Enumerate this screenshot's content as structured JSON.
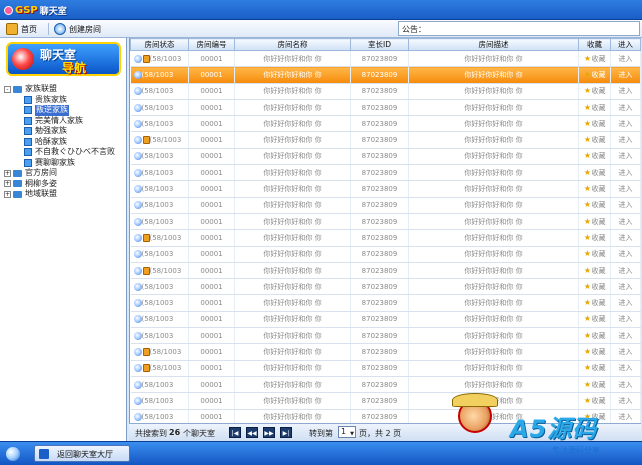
{
  "app": {
    "logo_text": "GSP",
    "logo_cn": "聊天室"
  },
  "toolbar": {
    "home_label": "首页",
    "create_label": "创建房间",
    "notice_label": "公告："
  },
  "sidebar": {
    "banner_line1": "聊天室",
    "banner_line2": "导航",
    "tree": [
      {
        "label": "家族联盟",
        "type": "group",
        "expanded": true
      },
      {
        "label": "贵族家族",
        "type": "leaf"
      },
      {
        "label": "叛逆家族",
        "type": "leaf",
        "selected": true
      },
      {
        "label": "完美情人家族",
        "type": "leaf"
      },
      {
        "label": "勉强家族",
        "type": "leaf"
      },
      {
        "label": "哈酥家族",
        "type": "leaf"
      },
      {
        "label": "不自救ぐひひべ不言败",
        "type": "leaf"
      },
      {
        "label": "赛聊聊家族",
        "type": "leaf"
      },
      {
        "label": "官方房间",
        "type": "group",
        "expanded": false
      },
      {
        "label": "桐柳多姿",
        "type": "group",
        "expanded": false
      },
      {
        "label": "地域联盟",
        "type": "group",
        "expanded": false
      }
    ]
  },
  "table": {
    "headers": [
      "房间状态",
      "房间编号",
      "房间名称",
      "室长ID",
      "房间描述",
      "收藏",
      "进入"
    ],
    "rows": [
      {
        "status": "(58/1003",
        "id": "00001",
        "name": "你好好你好和你 你",
        "owner": "87023809",
        "desc": "你好好你好和你 你",
        "fav": "收藏",
        "enter": "进入",
        "lock": true
      },
      {
        "status": "(58/1003",
        "id": "00001",
        "name": "你好好你好和你 你",
        "owner": "87023809",
        "desc": "你好好你好和你 你",
        "fav": "收藏",
        "enter": "进入",
        "lock": false,
        "highlight": true
      },
      {
        "status": "(58/1003",
        "id": "00001",
        "name": "你好好你好和你 你",
        "owner": "87023809",
        "desc": "你好好你好和你 你",
        "fav": "收藏",
        "enter": "进入",
        "lock": false
      },
      {
        "status": "(58/1003",
        "id": "00001",
        "name": "你好好你好和你 你",
        "owner": "87023809",
        "desc": "你好好你好和你 你",
        "fav": "收藏",
        "enter": "进入",
        "lock": false
      },
      {
        "status": "(58/1003",
        "id": "00001",
        "name": "你好好你好和你 你",
        "owner": "87023809",
        "desc": "你好好你好和你 你",
        "fav": "收藏",
        "enter": "进入",
        "lock": false
      },
      {
        "status": "(58/1003",
        "id": "00001",
        "name": "你好好你好和你 你",
        "owner": "87023809",
        "desc": "你好好你好和你 你",
        "fav": "收藏",
        "enter": "进入",
        "lock": true
      },
      {
        "status": "(58/1003",
        "id": "00001",
        "name": "你好好你好和你 你",
        "owner": "87023809",
        "desc": "你好好你好和你 你",
        "fav": "收藏",
        "enter": "进入",
        "lock": false
      },
      {
        "status": "(58/1003",
        "id": "00001",
        "name": "你好好你好和你 你",
        "owner": "87023809",
        "desc": "你好好你好和你 你",
        "fav": "收藏",
        "enter": "进入",
        "lock": false
      },
      {
        "status": "(58/1003",
        "id": "00001",
        "name": "你好好你好和你 你",
        "owner": "87023809",
        "desc": "你好好你好和你 你",
        "fav": "收藏",
        "enter": "进入",
        "lock": false
      },
      {
        "status": "(58/1003",
        "id": "00001",
        "name": "你好好你好和你 你",
        "owner": "87023809",
        "desc": "你好好你好和你 你",
        "fav": "收藏",
        "enter": "进入",
        "lock": false
      },
      {
        "status": "(58/1003",
        "id": "00001",
        "name": "你好好你好和你 你",
        "owner": "87023809",
        "desc": "你好好你好和你 你",
        "fav": "收藏",
        "enter": "进入",
        "lock": false
      },
      {
        "status": "(58/1003",
        "id": "00001",
        "name": "你好好你好和你 你",
        "owner": "87023809",
        "desc": "你好好你好和你 你",
        "fav": "收藏",
        "enter": "进入",
        "lock": true
      },
      {
        "status": "(58/1003",
        "id": "00001",
        "name": "你好好你好和你 你",
        "owner": "87023809",
        "desc": "你好好你好和你 你",
        "fav": "收藏",
        "enter": "进入",
        "lock": false
      },
      {
        "status": "(58/1003",
        "id": "00001",
        "name": "你好好你好和你 你",
        "owner": "87023809",
        "desc": "你好好你好和你 你",
        "fav": "收藏",
        "enter": "进入",
        "lock": true
      },
      {
        "status": "(58/1003",
        "id": "00001",
        "name": "你好好你好和你 你",
        "owner": "87023809",
        "desc": "你好好你好和你 你",
        "fav": "收藏",
        "enter": "进入",
        "lock": false
      },
      {
        "status": "(58/1003",
        "id": "00001",
        "name": "你好好你好和你 你",
        "owner": "87023809",
        "desc": "你好好你好和你 你",
        "fav": "收藏",
        "enter": "进入",
        "lock": false
      },
      {
        "status": "(58/1003",
        "id": "00001",
        "name": "你好好你好和你 你",
        "owner": "87023809",
        "desc": "你好好你好和你 你",
        "fav": "收藏",
        "enter": "进入",
        "lock": false
      },
      {
        "status": "(58/1003",
        "id": "00001",
        "name": "你好好你好和你 你",
        "owner": "87023809",
        "desc": "你好好你好和你 你",
        "fav": "收藏",
        "enter": "进入",
        "lock": false
      },
      {
        "status": "(58/1003",
        "id": "00001",
        "name": "你好好你好和你 你",
        "owner": "87023809",
        "desc": "你好好你好和你 你",
        "fav": "收藏",
        "enter": "进入",
        "lock": true
      },
      {
        "status": "(58/1003",
        "id": "00001",
        "name": "你好好你好和你 你",
        "owner": "87023809",
        "desc": "你好好你好和你 你",
        "fav": "收藏",
        "enter": "进入",
        "lock": true
      },
      {
        "status": "(58/1003",
        "id": "00001",
        "name": "你好好你好和你 你",
        "owner": "87023809",
        "desc": "你好好你好和你 你",
        "fav": "收藏",
        "enter": "进入",
        "lock": false
      },
      {
        "status": "(58/1003",
        "id": "00001",
        "name": "你好好你好和你 你",
        "owner": "87023809",
        "desc": "你好好你好和你 你",
        "fav": "收藏",
        "enter": "进入",
        "lock": false
      },
      {
        "status": "(58/1003",
        "id": "00001",
        "name": "你好好你好和你 你",
        "owner": "87023809",
        "desc": "你好好你好和你 你",
        "fav": "收藏",
        "enter": "进入",
        "lock": false
      }
    ]
  },
  "pager": {
    "total_prefix": "共搜索到",
    "total_count": "26",
    "total_suffix": "个聊天室",
    "goto_label": "转到第",
    "page_value": "1",
    "page_suffix": "页，共 2 页",
    "first_icon": "first-page-icon",
    "prev_icon": "prev-page-icon",
    "next_icon": "next-page-icon",
    "last_icon": "last-page-icon"
  },
  "taskbar": {
    "back_label": "返回聊天室大厅"
  },
  "watermark": {
    "title": "A5源码",
    "subtitle": "专注源码分享"
  },
  "colors": {
    "highlight": "#f58a0a",
    "accent": "#1a5fc8",
    "header": "#cfe0f6"
  }
}
